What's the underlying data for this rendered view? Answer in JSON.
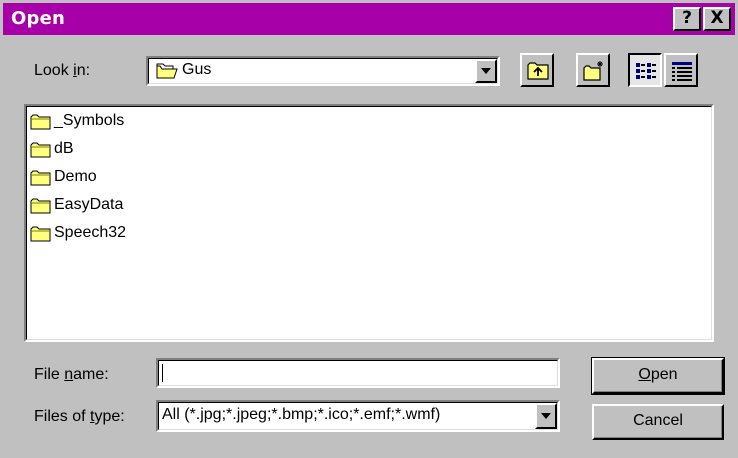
{
  "window": {
    "title": "Open",
    "help_button": "?",
    "close_button": "X"
  },
  "look_in": {
    "label_pre": "Look ",
    "label_accel": "i",
    "label_post": "n:",
    "value": "Gus",
    "icon": "folder-icon"
  },
  "toolbar": {
    "buttons": [
      {
        "name": "up-one-level",
        "icon": "folder-up-icon"
      },
      {
        "name": "create-new-folder",
        "icon": "new-folder-icon"
      },
      {
        "name": "list-view",
        "icon": "list-view-icon",
        "pressed": true
      },
      {
        "name": "details-view",
        "icon": "details-view-icon",
        "pressed": false
      }
    ]
  },
  "file_list": {
    "items": [
      {
        "label": "_Symbols",
        "icon": "folder-icon"
      },
      {
        "label": "dB",
        "icon": "folder-icon"
      },
      {
        "label": "Demo",
        "icon": "folder-icon"
      },
      {
        "label": "EasyData",
        "icon": "folder-icon"
      },
      {
        "label": "Speech32",
        "icon": "folder-icon"
      }
    ]
  },
  "file_name": {
    "label_pre": "File ",
    "label_accel": "n",
    "label_post": "ame:",
    "value": ""
  },
  "files_of_type": {
    "label_pre": "Files of ",
    "label_accel": "t",
    "label_post": "ype:",
    "value": "All (*.jpg;*.jpeg;*.bmp;*.ico;*.emf;*.wmf)"
  },
  "buttons": {
    "open_accel": "O",
    "open_rest": "pen",
    "cancel": "Cancel"
  },
  "colors": {
    "title_bar": "#a800a8",
    "face": "#c0c0c0",
    "folder": "#ffff80"
  }
}
